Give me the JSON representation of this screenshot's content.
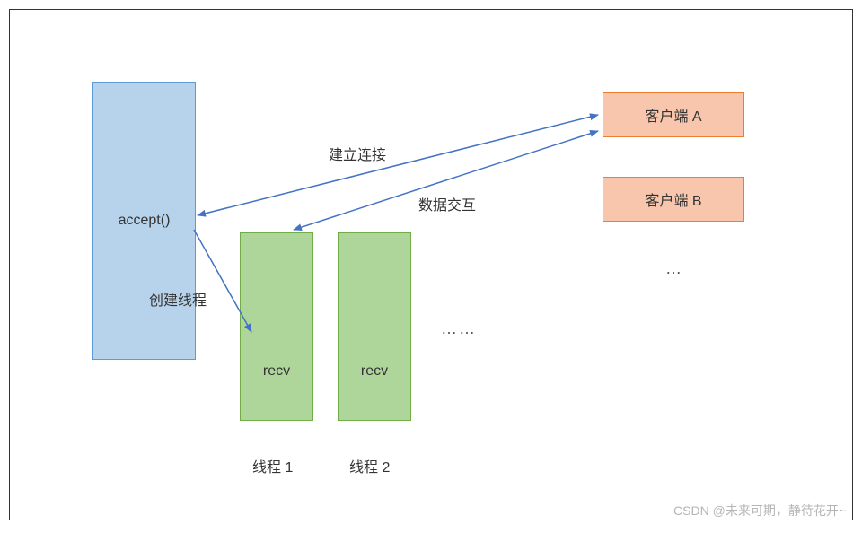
{
  "diagram": {
    "accept_label": "accept()",
    "thread1_box_label": "recv",
    "thread2_box_label": "recv",
    "client_a_label": "客户端 A",
    "client_b_label": "客户端 B",
    "connect_label": "建立连接",
    "interact_label": "数据交互",
    "create_thread_label": "创建线程",
    "threads_ellipsis": "……",
    "clients_ellipsis": "…",
    "thread1_label": "线程 1",
    "thread2_label": "线程 2"
  },
  "watermark": "CSDN @未来可期，静待花开~",
  "arrows": {
    "color": "#4472c4"
  }
}
